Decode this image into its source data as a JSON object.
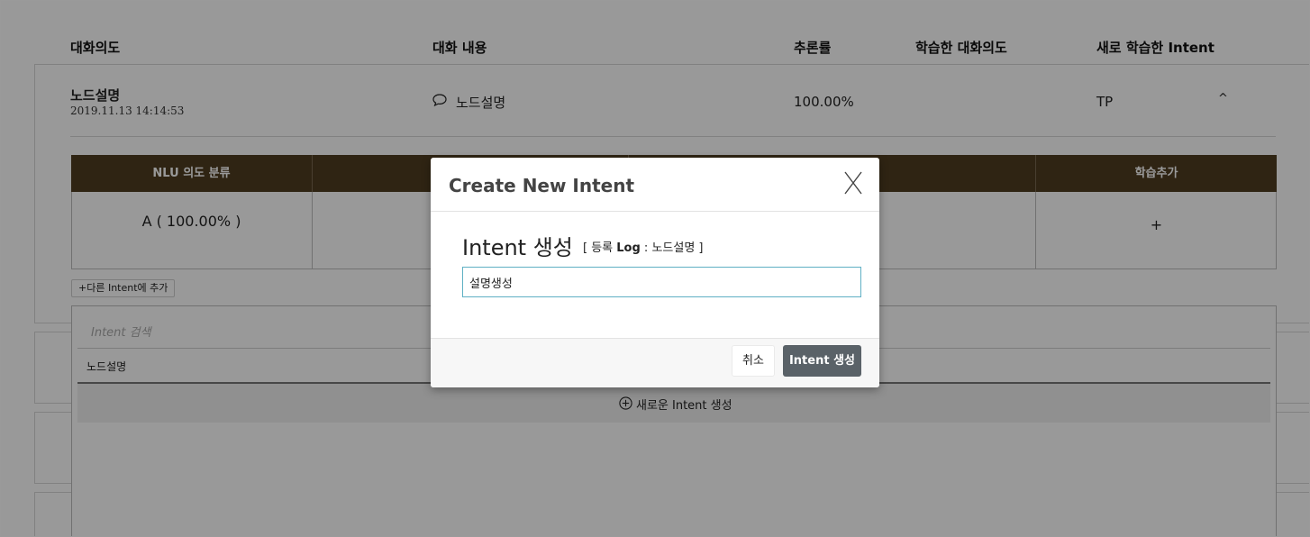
{
  "columns": {
    "intent": "대화의도",
    "content": "대화 내용",
    "rate": "추론률",
    "learned_intent": "학습한 대화의도",
    "new_learned_intent": "새로 학습한 Intent"
  },
  "entry": {
    "title": "노드설명",
    "date": "2019.11.13 14:14:53",
    "chat": "노드설명",
    "rate": "100.00%",
    "result": "TP",
    "caret": "^"
  },
  "table": {
    "headers": [
      "NLU 의도 분류",
      "학습추가"
    ],
    "row": {
      "classification": "A ( 100.00% )",
      "add": "+"
    }
  },
  "add_other_button": "+다른 Intent에 추가",
  "search": {
    "placeholder": "Intent 검색",
    "results": [
      "노드설명"
    ],
    "new_intent_label": "새로운 Intent 생성"
  },
  "modal": {
    "title": "Create New Intent",
    "close": "X",
    "heading": "Intent 생성",
    "log_prefix": "[ 등록 ",
    "log_key": "Log",
    "log_suffix": " : 노드설명 ]",
    "input_value": "설명생성",
    "cancel_label": "취소",
    "create_label": "Intent 생성"
  },
  "colors": {
    "table_header": "#4f3d21",
    "primary_button": "#5a6268",
    "input_border": "#5fb0c4"
  }
}
